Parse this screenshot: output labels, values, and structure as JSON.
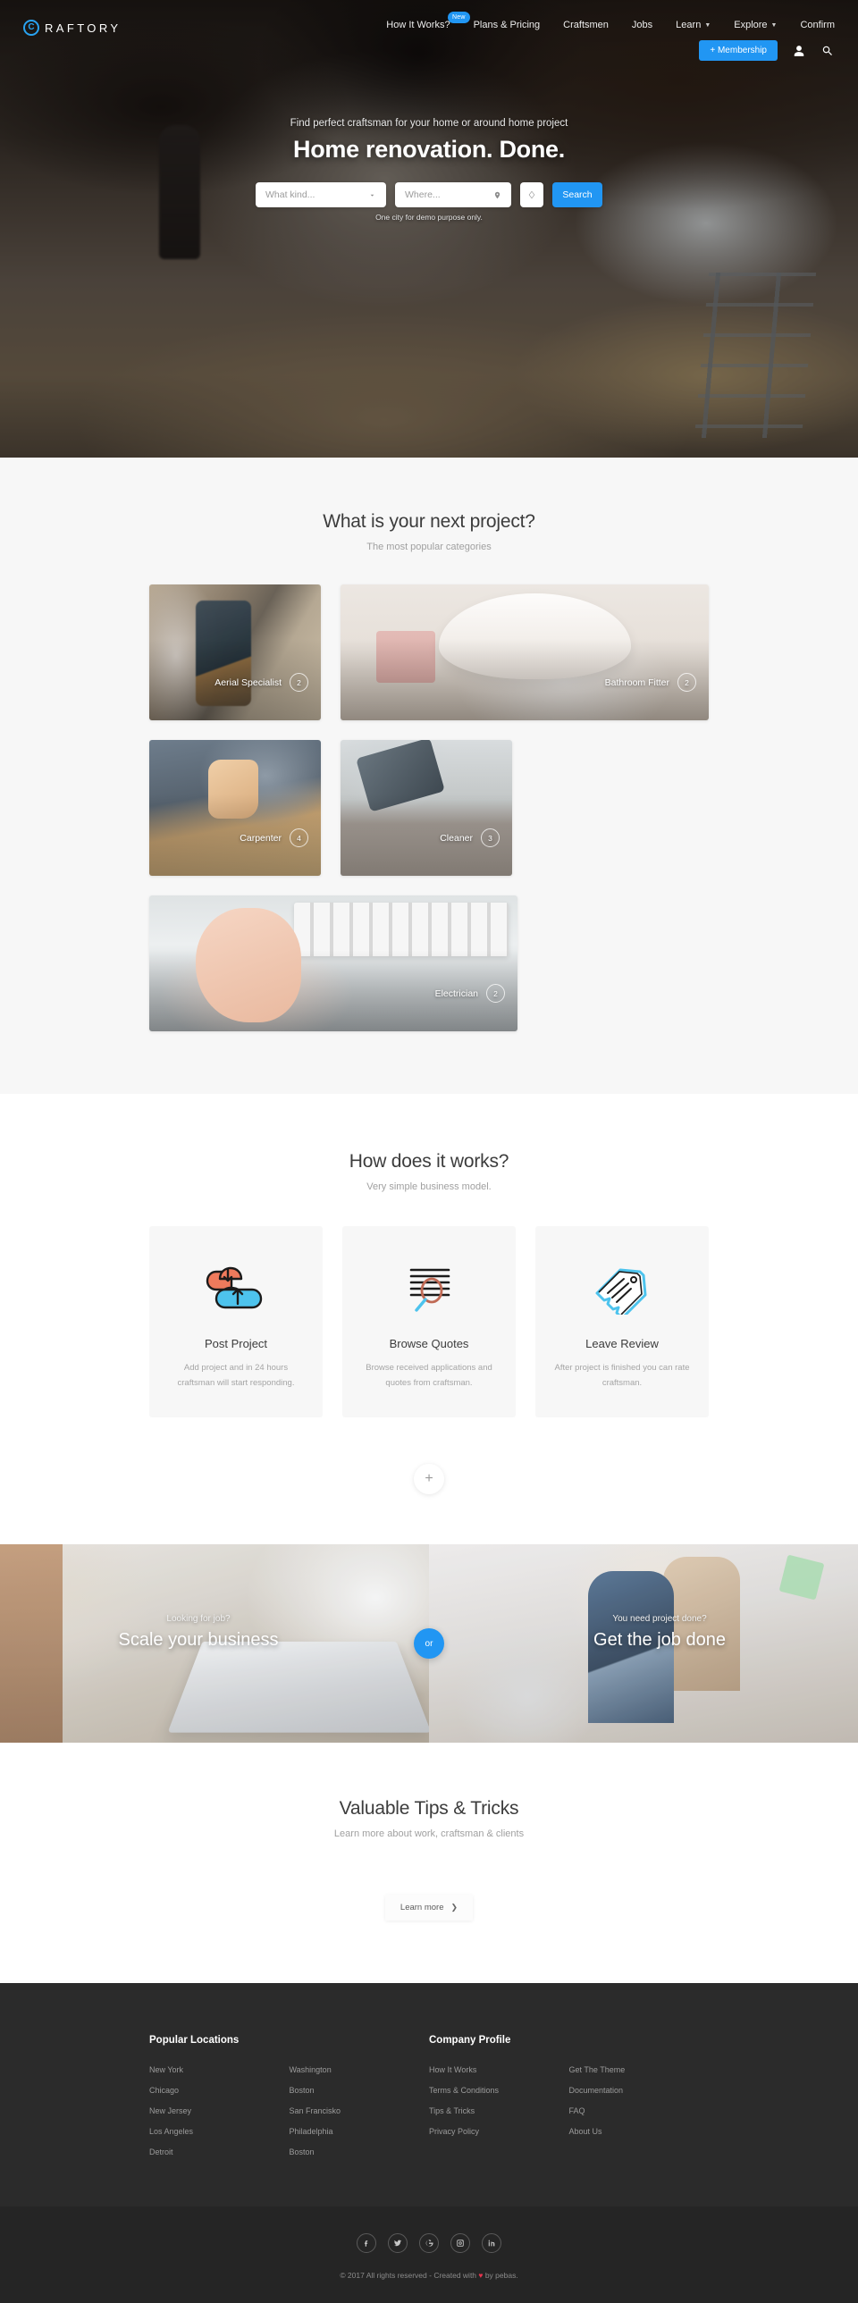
{
  "brand": {
    "mark_letter": "C",
    "name": "RAFTORY",
    "accent_color": "#2196f3"
  },
  "nav": {
    "links": [
      {
        "label": "How It Works?",
        "badge": "New",
        "caret": false
      },
      {
        "label": "Plans & Pricing",
        "badge": "",
        "caret": false
      },
      {
        "label": "Craftsmen",
        "badge": "",
        "caret": false
      },
      {
        "label": "Jobs",
        "badge": "",
        "caret": false
      },
      {
        "label": "Learn",
        "badge": "",
        "caret": true
      },
      {
        "label": "Explore",
        "badge": "",
        "caret": true
      },
      {
        "label": "Confirm",
        "badge": "",
        "caret": false
      }
    ],
    "membership_label": "+ Membership",
    "account_icon": "user-icon",
    "search_icon": "search-icon"
  },
  "hero": {
    "subtitle": "Find perfect craftsman for your home or around home project",
    "title": "Home renovation. Done.",
    "kind_placeholder": "What kind...",
    "kind_value": "",
    "where_placeholder": "Where...",
    "where_value": "",
    "search_label": "Search",
    "note": "One city for demo purpose only."
  },
  "categories": {
    "title": "What is your next project?",
    "subtitle": "The most popular categories",
    "items": [
      {
        "label": "Aerial Specialist",
        "count": "2",
        "size": "small",
        "photo": "ph-aerial"
      },
      {
        "label": "Bathroom Fitter",
        "count": "2",
        "size": "large",
        "photo": "ph-bathroom"
      },
      {
        "label": "Carpenter",
        "count": "4",
        "size": "small",
        "photo": "ph-carpenter"
      },
      {
        "label": "Cleaner",
        "count": "3",
        "size": "small",
        "photo": "ph-cleaner"
      },
      {
        "label": "Electrician",
        "count": "2",
        "size": "large",
        "photo": "ph-electrician"
      }
    ]
  },
  "how": {
    "title": "How does it works?",
    "subtitle": "Very simple business model.",
    "cards": [
      {
        "icon": "cloud-upload-download-icon",
        "title": "Post Project",
        "desc": "Add project and in 24 hours craftsman will start responding."
      },
      {
        "icon": "document-search-icon",
        "title": "Browse Quotes",
        "desc": "Browse received applications and quotes from craftsman."
      },
      {
        "icon": "tag-review-icon",
        "title": "Leave Review",
        "desc": "After project is finished you can rate craftsman."
      }
    ],
    "expand_label": "+"
  },
  "split": {
    "left": {
      "kicker": "Looking for job?",
      "heading": "Scale your business"
    },
    "divider_label": "or",
    "right": {
      "kicker": "You need project done?",
      "heading": "Get the job done"
    }
  },
  "tips": {
    "title": "Valuable Tips & Tricks",
    "subtitle": "Learn more about work, craftsman & clients",
    "learn_more_label": "Learn more",
    "learn_more_arrow": "❯"
  },
  "footer": {
    "columns": [
      {
        "title": "Popular Locations",
        "lists": [
          [
            "New York",
            "Chicago",
            "New Jersey",
            "Los Angeles",
            "Detroit"
          ],
          [
            "Washington",
            "Boston",
            "San Francisko",
            "Philadelphia",
            "Boston"
          ]
        ]
      },
      {
        "title": "Company Profile",
        "lists": [
          [
            "How It Works",
            "Terms & Conditions",
            "Tips & Tricks",
            "Privacy Policy"
          ],
          [
            "Get The Theme",
            "Documentation",
            "FAQ",
            "About Us"
          ]
        ]
      }
    ],
    "socials": [
      {
        "name": "facebook-icon"
      },
      {
        "name": "twitter-icon"
      },
      {
        "name": "google-icon"
      },
      {
        "name": "instagram-icon"
      },
      {
        "name": "linkedin-icon"
      }
    ],
    "copyright_before": "© 2017 All rights reserved - Created with ",
    "copyright_heart": "♥",
    "copyright_after": " by pebas."
  }
}
